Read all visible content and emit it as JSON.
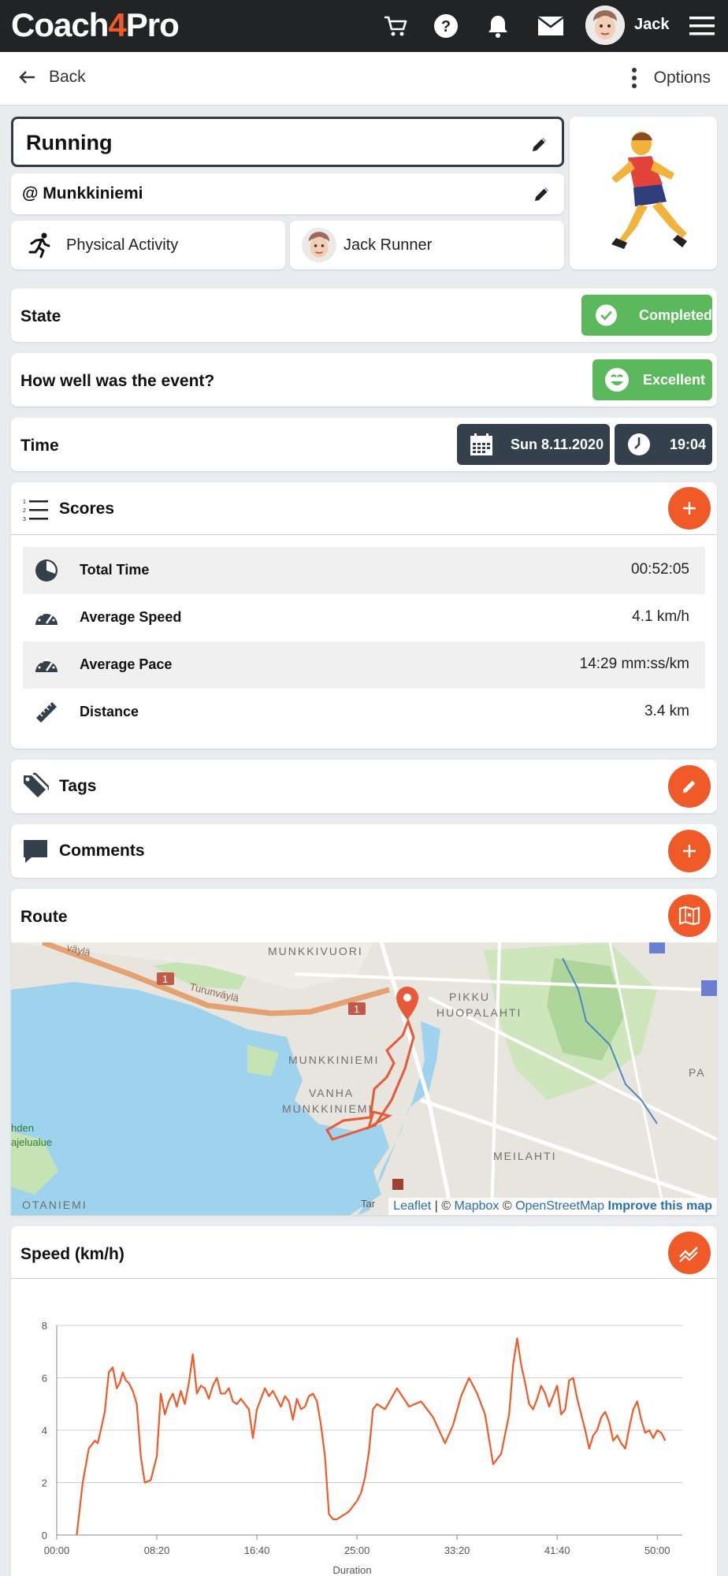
{
  "app": {
    "logo_a": "Coach",
    "logo_b": "4",
    "logo_c": "Pro",
    "username": "Jack"
  },
  "nav": {
    "back_label": "Back",
    "options_label": "Options"
  },
  "event": {
    "title": "Running",
    "location": "@ Munkkiniemi",
    "category": "Physical Activity",
    "athlete": "Jack Runner"
  },
  "state": {
    "label": "State",
    "value": "Completed"
  },
  "rating": {
    "label": "How well was the event?",
    "value": "Excellent"
  },
  "time": {
    "label": "Time",
    "date": "Sun 8.11.2020",
    "clock": "19:04"
  },
  "scores": {
    "title": "Scores",
    "items": [
      {
        "name": "Total Time",
        "value": "00:52:05",
        "icon": "clock-pie-icon"
      },
      {
        "name": "Average Speed",
        "value": "4.1 km/h",
        "icon": "speedometer-icon"
      },
      {
        "name": "Average Pace",
        "value": "14:29 mm:ss/km",
        "icon": "speedometer-icon"
      },
      {
        "name": "Distance",
        "value": "3.4 km",
        "icon": "ruler-icon"
      }
    ]
  },
  "tags": {
    "title": "Tags"
  },
  "comments": {
    "title": "Comments"
  },
  "route": {
    "title": "Route",
    "map_labels": [
      "MUNKKIVUORI",
      "PIKKU",
      "HUOPALAHTI",
      "MUNKKINIEMI",
      "VANHA",
      "MUNKKINIEMI",
      "MEILAHTI",
      "OTANIEMI",
      "Turunväylä",
      "1",
      "1",
      "PA",
      "hden",
      "ajelualue",
      "Tar",
      "väylä"
    ],
    "attribution": {
      "leaflet": "Leaflet",
      "sep": " | © ",
      "mapbox": "Mapbox",
      "sep2": " © ",
      "osm": "OpenStreetMap",
      "improve": "Improve this map"
    }
  },
  "speed_chart": {
    "title": "Speed (km/h)"
  },
  "colors": {
    "accent": "#f05a28",
    "green": "#5cb85c",
    "dark": "#34404c",
    "topbar": "#222325"
  },
  "chart_data": {
    "type": "line",
    "title": "Speed (km/h)",
    "xlabel": "Duration",
    "ylabel": "",
    "x_ticks": [
      "00:00",
      "08:20",
      "16:40",
      "25:00",
      "33:20",
      "41:40",
      "50:00"
    ],
    "y_ticks": [
      "0",
      "2",
      "4",
      "6",
      "8"
    ],
    "xlim_seconds": [
      0,
      3125
    ],
    "ylim": [
      0,
      8
    ],
    "grid": true,
    "series": [
      {
        "name": "",
        "x_seconds": [
          100,
          130,
          160,
          190,
          205,
          220,
          240,
          260,
          280,
          300,
          315,
          330,
          345,
          360,
          380,
          400,
          420,
          440,
          470,
          500,
          520,
          540,
          560,
          580,
          600,
          620,
          640,
          660,
          680,
          700,
          720,
          740,
          760,
          780,
          800,
          820,
          840,
          860,
          880,
          900,
          920,
          940,
          960,
          980,
          1000,
          1020,
          1040,
          1060,
          1080,
          1100,
          1120,
          1140,
          1160,
          1180,
          1200,
          1220,
          1240,
          1260,
          1280,
          1300,
          1320,
          1340,
          1360,
          1380,
          1400,
          1420,
          1440,
          1460,
          1480,
          1500,
          1520,
          1540,
          1560,
          1580,
          1600,
          1640,
          1700,
          1760,
          1820,
          1880,
          1940,
          1980,
          2020,
          2060,
          2100,
          2140,
          2180,
          2220,
          2260,
          2280,
          2300,
          2320,
          2340,
          2360,
          2380,
          2400,
          2420,
          2440,
          2460,
          2480,
          2500,
          2520,
          2540,
          2560,
          2580,
          2600,
          2620,
          2640,
          2660,
          2680,
          2700,
          2720,
          2740,
          2760,
          2780,
          2800,
          2820,
          2840,
          2860,
          2880,
          2900,
          2920,
          2940,
          2960,
          2980,
          3000,
          3020,
          3040,
          3060,
          3080,
          3100,
          3120
        ],
        "values": [
          0,
          2.0,
          3.3,
          3.6,
          3.5,
          4.0,
          4.7,
          6.2,
          6.4,
          5.6,
          5.8,
          6.2,
          5.9,
          5.8,
          5.5,
          5.0,
          3.0,
          2.0,
          2.1,
          3.0,
          5.4,
          4.6,
          5.1,
          5.4,
          4.9,
          5.5,
          5.0,
          5.8,
          6.9,
          5.4,
          5.7,
          5.6,
          5.2,
          5.7,
          6.0,
          5.4,
          5.4,
          5.6,
          5.1,
          5.0,
          5.2,
          5.0,
          4.8,
          3.7,
          4.8,
          5.2,
          5.6,
          5.3,
          5.5,
          5.2,
          4.9,
          5.3,
          5.1,
          4.4,
          5.2,
          4.8,
          4.9,
          5.3,
          5.4,
          5.1,
          4.2,
          3.0,
          0.8,
          0.6,
          0.6,
          0.7,
          0.8,
          0.9,
          1.1,
          1.3,
          1.6,
          2.2,
          3.2,
          4.8,
          5.0,
          4.8,
          5.6,
          4.9,
          5.1,
          4.5,
          3.5,
          4.2,
          5.3,
          6.0,
          5.4,
          4.6,
          2.7,
          3.1,
          4.6,
          6.5,
          7.5,
          6.5,
          5.8,
          5.0,
          4.8,
          5.2,
          5.7,
          5.4,
          4.9,
          5.3,
          5.7,
          4.6,
          4.8,
          5.9,
          6.0,
          5.2,
          4.6,
          4.0,
          3.3,
          3.8,
          4.0,
          4.5,
          4.7,
          4.3,
          3.6,
          3.8,
          3.5,
          3.3,
          4.1,
          4.8,
          5.1,
          4.4,
          3.9,
          4.0,
          3.7,
          4.0,
          3.9,
          3.6
        ]
      }
    ]
  }
}
